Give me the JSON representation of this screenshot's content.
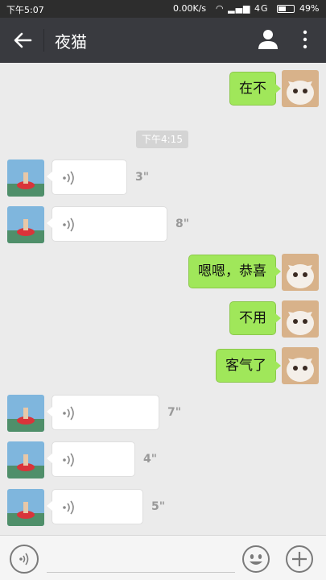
{
  "status_bar": {
    "time": "下午5:07",
    "network_speed": "0.00K/s",
    "signal": "4G",
    "battery": "49%"
  },
  "header": {
    "title": "夜猫",
    "back_icon": "back-arrow-icon",
    "profile_icon": "person-icon",
    "more_icon": "more-vertical-icon"
  },
  "messages": [
    {
      "side": "right",
      "type": "text",
      "text": "在不"
    },
    {
      "type": "timestamp",
      "text": "下午4:15"
    },
    {
      "side": "left",
      "type": "voice",
      "duration": "3\""
    },
    {
      "side": "left",
      "type": "voice",
      "duration": "8\""
    },
    {
      "side": "right",
      "type": "text",
      "text": "嗯嗯，恭喜"
    },
    {
      "side": "right",
      "type": "text",
      "text": "不用"
    },
    {
      "side": "right",
      "type": "text",
      "text": "客气了"
    },
    {
      "side": "left",
      "type": "voice",
      "duration": "7\""
    },
    {
      "side": "left",
      "type": "voice",
      "duration": "4\""
    },
    {
      "side": "left",
      "type": "voice",
      "duration": "5\""
    }
  ],
  "input_bar": {
    "voice_icon": "voice-mode-icon",
    "input_value": "",
    "emoji_icon": "emoji-icon",
    "plus_icon": "plus-icon"
  },
  "colors": {
    "outgoing_bubble": "#a0e75a",
    "incoming_bubble": "#ffffff",
    "chat_background": "#ebebeb",
    "title_bar": "#393a3f"
  }
}
